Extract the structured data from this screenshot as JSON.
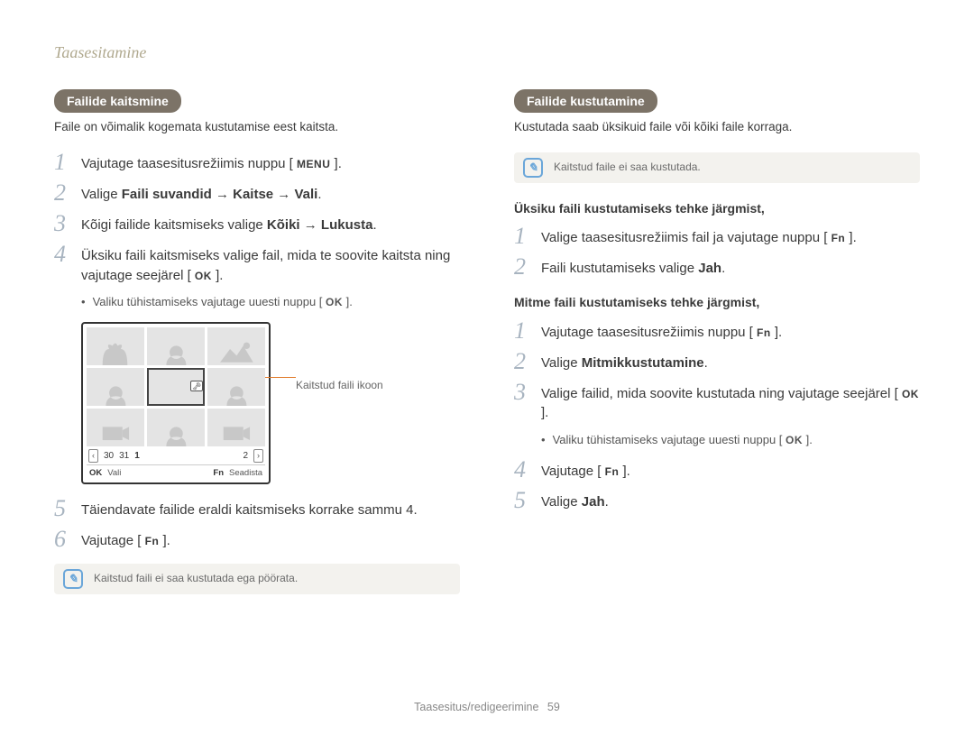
{
  "page_title": "Taasesitamine",
  "left": {
    "badge": "Failide kaitsmine",
    "intro": "Faile on võimalik kogemata kustutamise eest kaitsta.",
    "step1_a": "Vajutage taasesitusrežiimis nuppu [ ",
    "step1_btn": "MENU",
    "step1_b": " ].",
    "step2_a": "Valige ",
    "step2_bold": "Faili suvandid → Kaitse → Vali",
    "step2_b": ".",
    "step3_a": "Kõigi failide kaitsmiseks valige ",
    "step3_bold": "Kõiki → Lukusta",
    "step3_b": ".",
    "step4_a": "Üksiku faili kaitsmiseks valige fail, mida te soovite kaitsta ning vajutage seejärel [ ",
    "step4_btn": "OK",
    "step4_b": " ].",
    "sub_a": "Valiku tühistamiseks vajutage uuesti nuppu [ ",
    "sub_btn": "OK",
    "sub_b": " ].",
    "callout": "Kaitstud faili ikoon",
    "date_30": "30",
    "date_31": "31",
    "date_1": "1",
    "date_2": "2",
    "bar_ok": "OK",
    "bar_vali": "Vali",
    "bar_fn": "Fn",
    "bar_seadista": "Seadista",
    "step5": "Täiendavate failide eraldi kaitsmiseks korrake sammu 4.",
    "step6_a": "Vajutage [ ",
    "step6_btn": "Fn",
    "step6_b": " ].",
    "note": "Kaitstud faili ei saa kustutada ega pöörata."
  },
  "right": {
    "badge": "Failide kustutamine",
    "intro": "Kustutada saab üksikuid faile või kõiki faile korraga.",
    "note": "Kaitstud faile ei saa kustutada.",
    "sub1_head": "Üksiku faili kustutamiseks tehke järgmist,",
    "s1_step1_a": "Valige taasesitusrežiimis fail ja vajutage nuppu [ ",
    "s1_step1_btn": "Fn",
    "s1_step1_b": " ].",
    "s1_step2_a": "Faili kustutamiseks valige ",
    "s1_step2_bold": "Jah",
    "s1_step2_b": ".",
    "sub2_head": "Mitme faili kustutamiseks tehke järgmist,",
    "s2_step1_a": "Vajutage taasesitusrežiimis nuppu [ ",
    "s2_step1_btn": "Fn",
    "s2_step1_b": " ].",
    "s2_step2_a": "Valige ",
    "s2_step2_bold": "Mitmikkustutamine",
    "s2_step2_b": ".",
    "s2_step3_a": "Valige failid, mida soovite kustutada ning vajutage seejärel [ ",
    "s2_step3_btn": "OK",
    "s2_step3_b": " ].",
    "s2_sub_a": "Valiku tühistamiseks vajutage uuesti nuppu [ ",
    "s2_sub_btn": "OK",
    "s2_sub_b": " ].",
    "s2_step4_a": "Vajutage [ ",
    "s2_step4_btn": "Fn",
    "s2_step4_b": " ].",
    "s2_step5_a": "Valige ",
    "s2_step5_bold": "Jah",
    "s2_step5_b": "."
  },
  "footer": {
    "section": "Taasesitus/redigeerimine",
    "page": "59"
  }
}
